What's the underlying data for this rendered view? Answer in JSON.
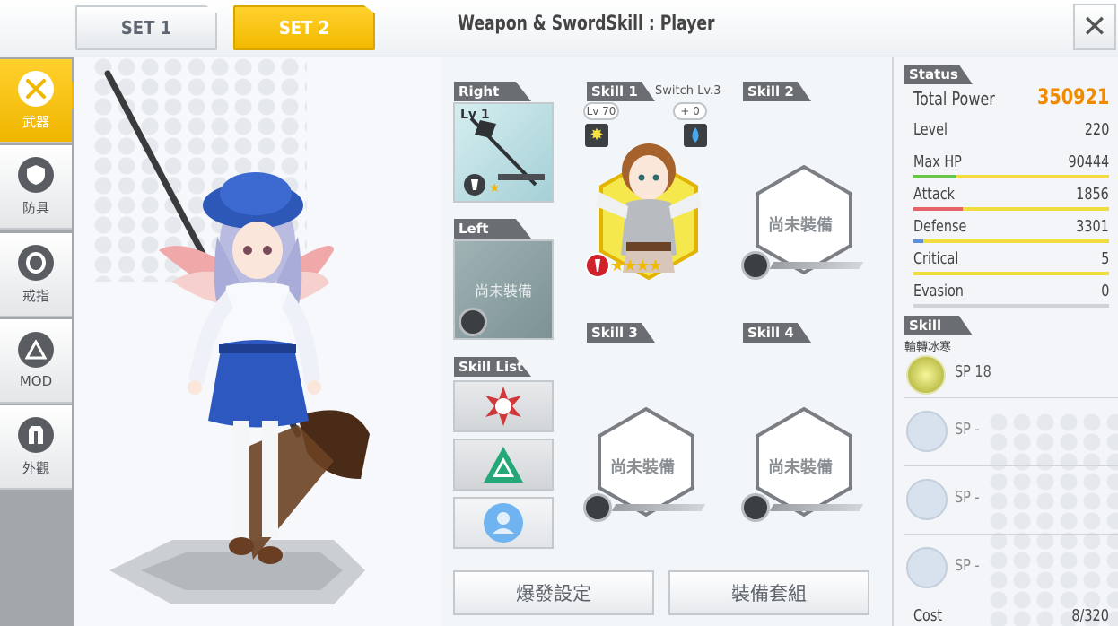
{
  "header": {
    "set_tabs": [
      {
        "label": "SET 1",
        "active": false
      },
      {
        "label": "SET 2",
        "active": true
      }
    ],
    "title": "Weapon & SwordSkill : Player",
    "close_glyph": "✕"
  },
  "nav": {
    "items": [
      {
        "label": "武器",
        "icon": "swords-icon",
        "active": true
      },
      {
        "label": "防具",
        "icon": "shield-icon",
        "active": false
      },
      {
        "label": "戒指",
        "icon": "ring-icon",
        "active": false
      },
      {
        "label": "MOD",
        "icon": "mod-triangle-icon",
        "active": false
      },
      {
        "label": "外觀",
        "icon": "outfit-icon",
        "active": false
      }
    ]
  },
  "weapons": {
    "right_label": "Right",
    "right_level": "Lv 1",
    "left_label": "Left",
    "left_empty": "尚未裝備",
    "skill_list_label": "Skill List"
  },
  "skills": {
    "skill1_label": "Skill 1",
    "skill1_switch": "Switch Lv.3",
    "skill1_level": "Lv 70",
    "skill1_plus": "+ 0",
    "skill1_stars": "★★★★",
    "skill2_label": "Skill 2",
    "skill3_label": "Skill 3",
    "skill4_label": "Skill 4",
    "empty": "尚未裝備"
  },
  "buttons": {
    "burst": "爆發設定",
    "equip_set": "裝備套組"
  },
  "status": {
    "header": "Status",
    "total_power_label": "Total Power",
    "total_power": "350921",
    "level_label": "Level",
    "level": "220",
    "rows": [
      {
        "label": "Max HP",
        "value": "90444",
        "fill": 0.22,
        "color": "#6ac64a"
      },
      {
        "label": "Attack",
        "value": "1856",
        "fill": 0.25,
        "color": "#e8626a"
      },
      {
        "label": "Defense",
        "value": "3301",
        "fill": 0.05,
        "color": "#5b8fd6"
      },
      {
        "label": "Critical",
        "value": "5",
        "fill": 0.0,
        "color": "#f0dc3c"
      },
      {
        "label": "Evasion",
        "value": "0",
        "fill": 0.0,
        "color": "#cfd3d7"
      }
    ]
  },
  "skill_panel": {
    "header": "Skill",
    "skill_name": "輪轉冰寒",
    "sp_main": "SP 18",
    "sp_empty": "SP -",
    "cost_label": "Cost",
    "cost_value": "8/320"
  },
  "colors": {
    "accent_yellow": "#f2b900",
    "power_orange": "#f08a00"
  }
}
